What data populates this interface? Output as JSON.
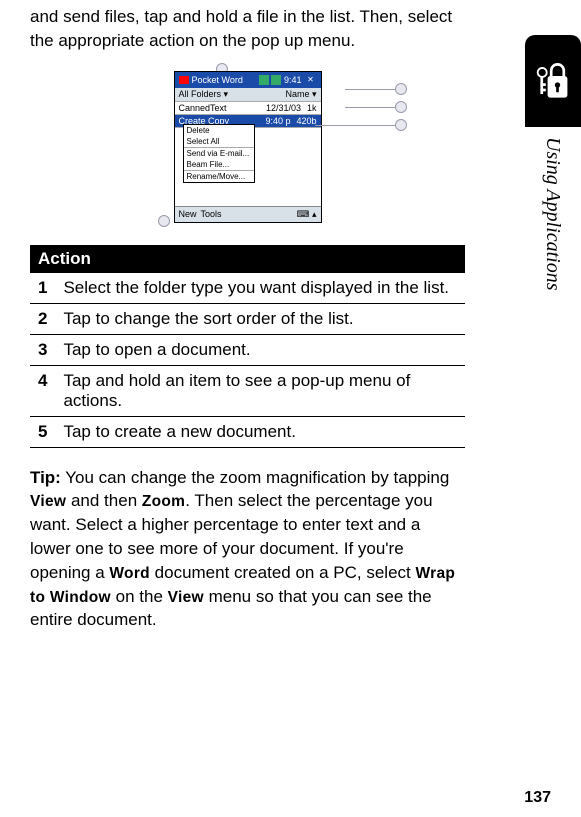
{
  "intro": "and send files, tap and hold a file in the list. Then, select the appropriate action on the pop up menu.",
  "screenshot": {
    "title": "Pocket Word",
    "time": "9:41",
    "folders_label": "All Folders",
    "sort_label": "Name",
    "rows": [
      {
        "name": "CannedText",
        "date": "12/31/03",
        "size": "1k"
      },
      {
        "name": "Create Copy",
        "date": "9:40 p",
        "size": "420b"
      }
    ],
    "menu": [
      "Delete",
      "Select All",
      "Send via E-mail...",
      "Beam File...",
      "Rename/Move..."
    ],
    "footer": [
      "New",
      "Tools"
    ]
  },
  "table": {
    "header": "Action",
    "rows": [
      {
        "n": "1",
        "text": "Select the folder type you want displayed in the list."
      },
      {
        "n": "2",
        "text": "Tap to change the sort order of the list."
      },
      {
        "n": "3",
        "text": "Tap to open a document."
      },
      {
        "n": "4",
        "text": "Tap and hold an item to see a pop-up menu of actions."
      },
      {
        "n": "5",
        "text": "Tap to create a new document."
      }
    ]
  },
  "tip": {
    "label": "Tip:",
    "t1": " You can change the zoom magnification by tapping ",
    "w1": "View",
    "t2": " and then ",
    "w2": "Zoom",
    "t3": ". Then select the percentage you want. Select a higher percentage to enter text and a lower one to see more of your document. If you're opening a ",
    "w3": "Word",
    "t4": " document created on a PC, select ",
    "w4": "Wrap to Window",
    "t5": " on the ",
    "w5": "View",
    "t6": " menu so that you can see the entire document."
  },
  "side_label": "Using Applications",
  "page_number": "137"
}
